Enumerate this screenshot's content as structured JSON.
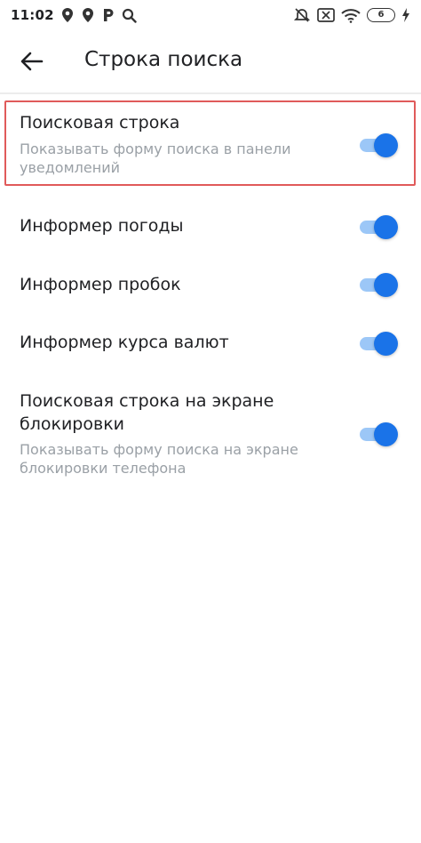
{
  "status_bar": {
    "time": "11:02",
    "battery_level": "6",
    "icons": [
      "location-pin-icon",
      "location-pin-icon",
      "parking-icon",
      "search-icon",
      "alarm-off-icon",
      "sim-off-icon",
      "wifi-icon",
      "battery-icon",
      "charging-bolt-icon"
    ]
  },
  "app_bar": {
    "back_icon": "back-arrow-icon",
    "title": "Строка поиска"
  },
  "settings": [
    {
      "title": "Поисковая строка",
      "description": "Показывать форму поиска в панели уведомлений",
      "enabled": true
    },
    {
      "title": "Информер погоды",
      "enabled": true
    },
    {
      "title": "Информер пробок",
      "enabled": true
    },
    {
      "title": "Информер курса валют",
      "enabled": true
    },
    {
      "title": "Поисковая строка на экране блокировки",
      "description": "Показывать форму поиска на экране блокировки телефона",
      "enabled": true
    }
  ],
  "colors": {
    "accent": "#1a73e8",
    "track": "#9cc7f7",
    "highlight": "#e05a5a",
    "secondary_text": "#9aa0a6"
  }
}
